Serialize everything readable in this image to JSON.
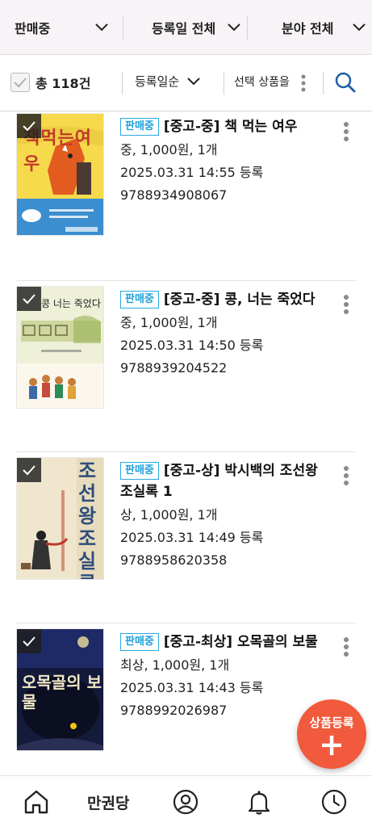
{
  "filters": {
    "status": "판매중",
    "date": "등록일 전체",
    "category": "분야 전체"
  },
  "toolbar": {
    "total": "총 118건",
    "sort": "등록일순",
    "select": "선택 상품을"
  },
  "items": [
    {
      "badge": "판매중",
      "title": "[중고-중] 책 먹는 여우",
      "detail": "중, 1,000원, 1개",
      "date": "2025.03.31 14:55 등록",
      "isbn": "9788934908067",
      "cover_title": "책먹는여우"
    },
    {
      "badge": "판매중",
      "title": "[중고-중] 콩, 너는 죽었다",
      "detail": "중, 1,000원, 1개",
      "date": "2025.03.31 14:50 등록",
      "isbn": "9788939204522",
      "cover_title": "콩 너는 죽었다"
    },
    {
      "badge": "판매중",
      "title": "[중고-상] 박시백의 조선왕조실록 1",
      "detail": "상, 1,000원, 1개",
      "date": "2025.03.31 14:49 등록",
      "isbn": "9788958620358",
      "cover_title": "조선왕조실록"
    },
    {
      "badge": "판매중",
      "title": "[중고-최상] 오목골의 보물",
      "detail": "최상, 1,000원, 1개",
      "date": "2025.03.31 14:43 등록",
      "isbn": "9788992026987",
      "cover_title": "오목골의 보물"
    }
  ],
  "fab": {
    "label": "상품등록",
    "plus": "+"
  },
  "nav": {
    "brand": "만권당"
  },
  "colors": {
    "accent": "#1fa0d8",
    "fab": "#f15a3c",
    "header_bg": "#f7f3f6"
  }
}
